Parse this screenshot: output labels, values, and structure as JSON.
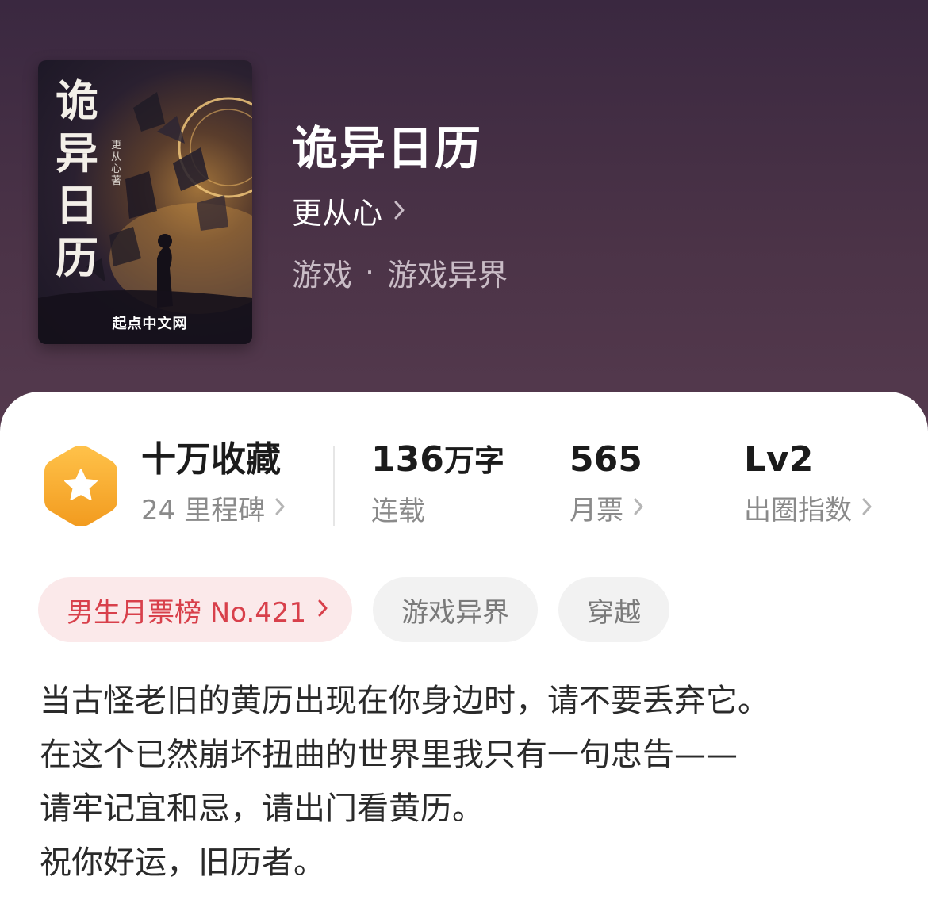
{
  "book": {
    "cover": {
      "title": "诡异日历",
      "author_vertical": "更从心 著",
      "publisher_logo": "起点中文网"
    },
    "title": "诡异日历",
    "author": "更从心",
    "genre": "游戏",
    "subgenre": "游戏异界",
    "genre_separator": "·"
  },
  "stats": {
    "milestone": {
      "icon": "star-hexagon-icon",
      "value": "十万收藏",
      "label": "24 里程碑"
    },
    "words": {
      "value_num": "136",
      "value_unit": "万字",
      "label": "连载"
    },
    "monthly_tickets": {
      "value": "565",
      "label": "月票"
    },
    "influence": {
      "value": "Lv2",
      "label": "出圈指数"
    }
  },
  "tags": {
    "rank": "男生月票榜 No.421",
    "tag1": "游戏异界",
    "tag2": "穿越"
  },
  "description": {
    "line1": "当古怪老旧的黄历出现在你身边时，请不要丢弃它。",
    "line2": "在这个已然崩坏扭曲的世界里我只有一句忠告——",
    "line3": "请牢记宜和忌，请出门看黄历。",
    "line4": "祝你好运，旧历者。"
  },
  "colors": {
    "header_bg": "#4b3347",
    "rank_tag_text": "#d8404b",
    "rank_tag_bg": "#fbe9ea",
    "milestone_icon": "#f5a623"
  }
}
